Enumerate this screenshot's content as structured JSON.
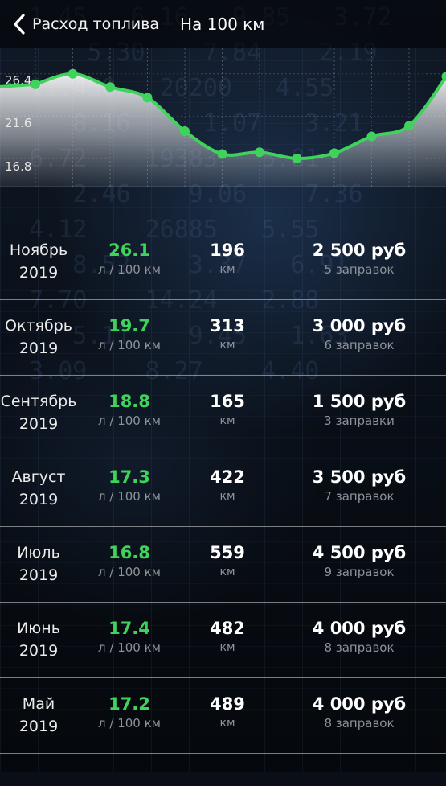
{
  "header": {
    "back_label": "Расход топлива",
    "title": "На 100 км"
  },
  "chart_data": {
    "type": "line",
    "y_ticks": [
      "26.4",
      "21.6",
      "16.8"
    ],
    "ylim": [
      13.6,
      29.3
    ],
    "points": [
      25.2,
      26.4,
      24.9,
      23.7,
      19.9,
      17.3,
      17.5,
      16.8,
      17.4,
      19.3,
      20.5,
      26.1
    ],
    "line_color": "#3fd35c",
    "grid": true
  },
  "rows": [
    {
      "month": "Ноябрь",
      "year": "2019",
      "consumption": "26.1",
      "consumption_unit": "л / 100 км",
      "distance": "196",
      "distance_unit": "км",
      "cost": "2 500 руб",
      "refuels": "5 заправок"
    },
    {
      "month": "Октябрь",
      "year": "2019",
      "consumption": "19.7",
      "consumption_unit": "л / 100 км",
      "distance": "313",
      "distance_unit": "км",
      "cost": "3 000 руб",
      "refuels": "6 заправок"
    },
    {
      "month": "Сентябрь",
      "year": "2019",
      "consumption": "18.8",
      "consumption_unit": "л / 100 км",
      "distance": "165",
      "distance_unit": "км",
      "cost": "1 500 руб",
      "refuels": "3 заправки"
    },
    {
      "month": "Август",
      "year": "2019",
      "consumption": "17.3",
      "consumption_unit": "л / 100 км",
      "distance": "422",
      "distance_unit": "км",
      "cost": "3 500 руб",
      "refuels": "7 заправок"
    },
    {
      "month": "Июль",
      "year": "2019",
      "consumption": "16.8",
      "consumption_unit": "л / 100 км",
      "distance": "559",
      "distance_unit": "км",
      "cost": "4 500 руб",
      "refuels": "9 заправок"
    },
    {
      "month": "Июнь",
      "year": "2019",
      "consumption": "17.4",
      "consumption_unit": "л / 100 км",
      "distance": "482",
      "distance_unit": "км",
      "cost": "4 000 руб",
      "refuels": "8 заправок"
    },
    {
      "month": "Май",
      "year": "2019",
      "consumption": "17.2",
      "consumption_unit": "л / 100 км",
      "distance": "489",
      "distance_unit": "км",
      "cost": "4 000 руб",
      "refuels": "8 заправок"
    }
  ],
  "colors": {
    "accent_green": "#3fd35c",
    "muted_text": "#8e9299"
  },
  "icons": {
    "back": "chevron-left-icon"
  }
}
